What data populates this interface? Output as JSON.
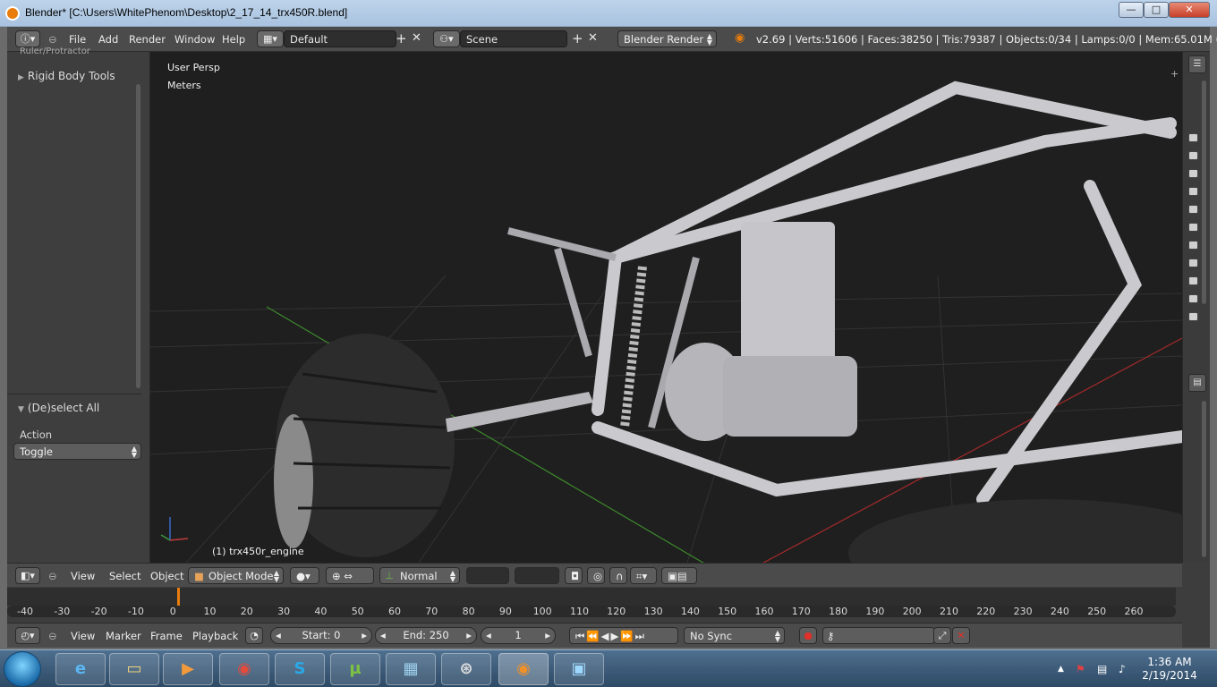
{
  "window": {
    "title": "Blender* [C:\\Users\\WhitePhenom\\Desktop\\2_17_14_trx450R.blend]",
    "minimize_label": "—",
    "maximize_label": "□",
    "close_label": "✕"
  },
  "info_header": {
    "menus": [
      "File",
      "Add",
      "Render",
      "Window",
      "Help"
    ],
    "layout": "Default",
    "scene": "Scene",
    "render_engine": "Blender Render",
    "stats": "v2.69 | Verts:51606 | Faces:38250 | Tris:79387 | Objects:0/34 | Lamps:0/0 | Mem:65.01M (0.11M)"
  },
  "tool_shelf": {
    "cut_label": "Ruler/Protractor",
    "panel_rigid_body": "Rigid Body Tools",
    "operator_title": "(De)select All",
    "action_label": "Action",
    "action_value": "Toggle"
  },
  "viewport": {
    "view_name": "User Persp",
    "units": "Meters",
    "active_object": "(1) trx450r_engine"
  },
  "view3d_header": {
    "menus": [
      "View",
      "Select",
      "Object"
    ],
    "mode": "Object Mode",
    "orientation": "Normal"
  },
  "timeline": {
    "ticks": [
      "-40",
      "-30",
      "-20",
      "-10",
      "0",
      "10",
      "20",
      "30",
      "40",
      "50",
      "60",
      "70",
      "80",
      "90",
      "100",
      "110",
      "120",
      "130",
      "140",
      "150",
      "160",
      "170",
      "180",
      "190",
      "200",
      "210",
      "220",
      "230",
      "240",
      "250",
      "260"
    ],
    "current_frame_marker": 0
  },
  "timeline_header": {
    "menus": [
      "View",
      "Marker",
      "Frame",
      "Playback"
    ],
    "start": "Start: 0",
    "end": "End: 250",
    "current": "1",
    "sync": "No Sync"
  },
  "taskbar": {
    "apps": [
      "ie-icon",
      "explorer-icon",
      "media-player-icon",
      "chrome-icon",
      "skype-icon",
      "utorrent-icon",
      "control-panel-icon",
      "steam-icon",
      "blender-icon",
      "photo-viewer-icon"
    ],
    "time": "1:36 AM",
    "date": "2/19/2014"
  },
  "colors": {
    "accent": "#e87d0d",
    "viewport_bg": "#1f1f1f",
    "panel_bg": "#3d3d3d",
    "header_bg": "#4b4b4b"
  }
}
